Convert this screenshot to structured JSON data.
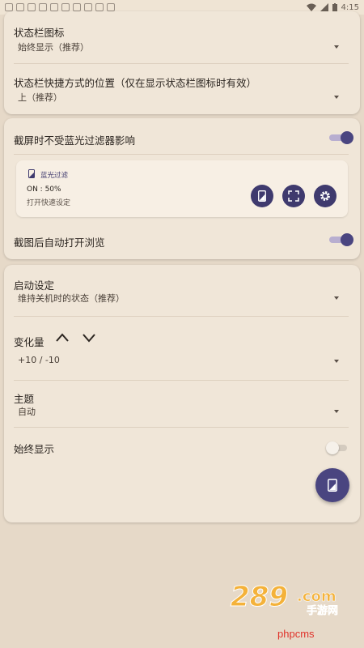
{
  "status_bar": {
    "time": "4:15"
  },
  "section1": {
    "status_icon_label": "状态栏图标",
    "status_icon_value": "始终显示（推荐）",
    "shortcut_position_label": "状态栏快捷方式的位置（仅在显示状态栏图标时有效）",
    "shortcut_position_value": "上（推荐）"
  },
  "section2": {
    "screenshot_label": "截屏时不受蓝光过滤器影响",
    "screenshot_toggle": "on",
    "preview": {
      "title": "蓝光过滤",
      "status": "ON : 50%",
      "subtitle": "打开快速设定"
    },
    "auto_open_label": "截图后自动打开浏览",
    "auto_open_toggle": "on"
  },
  "section3": {
    "startup_label": "启动设定",
    "startup_value": "维持关机时的状态（推荐）",
    "change_label": "变化量",
    "change_value": "+10 / -10",
    "theme_label": "主题",
    "theme_value": "自动",
    "always_show_label": "始终显示",
    "always_show_toggle": "off"
  },
  "watermark": {
    "logo_text": "289.com 手游网",
    "site": "phpcms"
  },
  "colors": {
    "accent": "#4a4580",
    "background": "#e6d9c8",
    "card": "#f0e6d8"
  }
}
